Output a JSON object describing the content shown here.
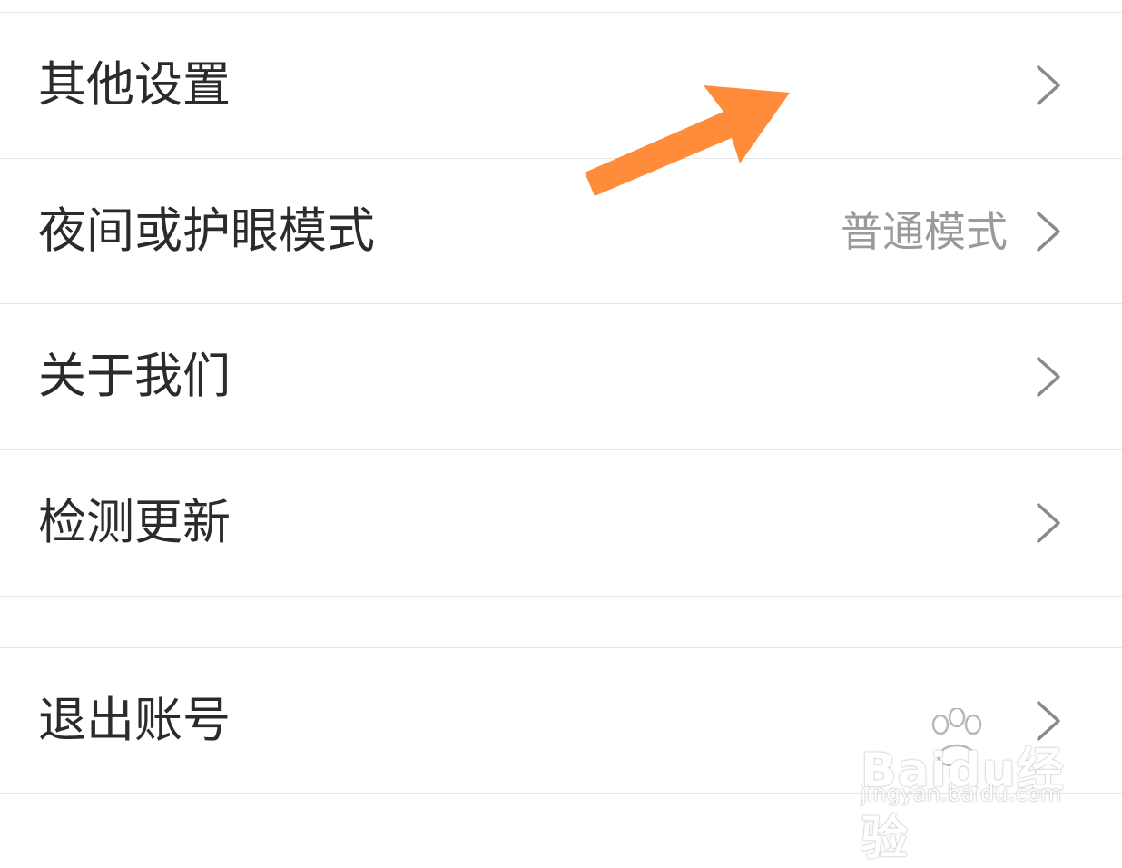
{
  "settings": {
    "items": [
      {
        "label": "其他设置",
        "value": ""
      },
      {
        "label": "夜间或护眼模式",
        "value": "普通模式"
      },
      {
        "label": "关于我们",
        "value": ""
      },
      {
        "label": "检测更新",
        "value": ""
      },
      {
        "label": "退出账号",
        "value": ""
      }
    ]
  },
  "annotation": {
    "arrow_color": "#ff8c3a"
  },
  "watermark": {
    "brand": "Baidu经验",
    "url": "jingyan.baidu.com"
  },
  "icons": {
    "chevron": "chevron-right-icon",
    "annotation": "orange-arrow-icon",
    "watermark_paw": "paw-icon"
  }
}
